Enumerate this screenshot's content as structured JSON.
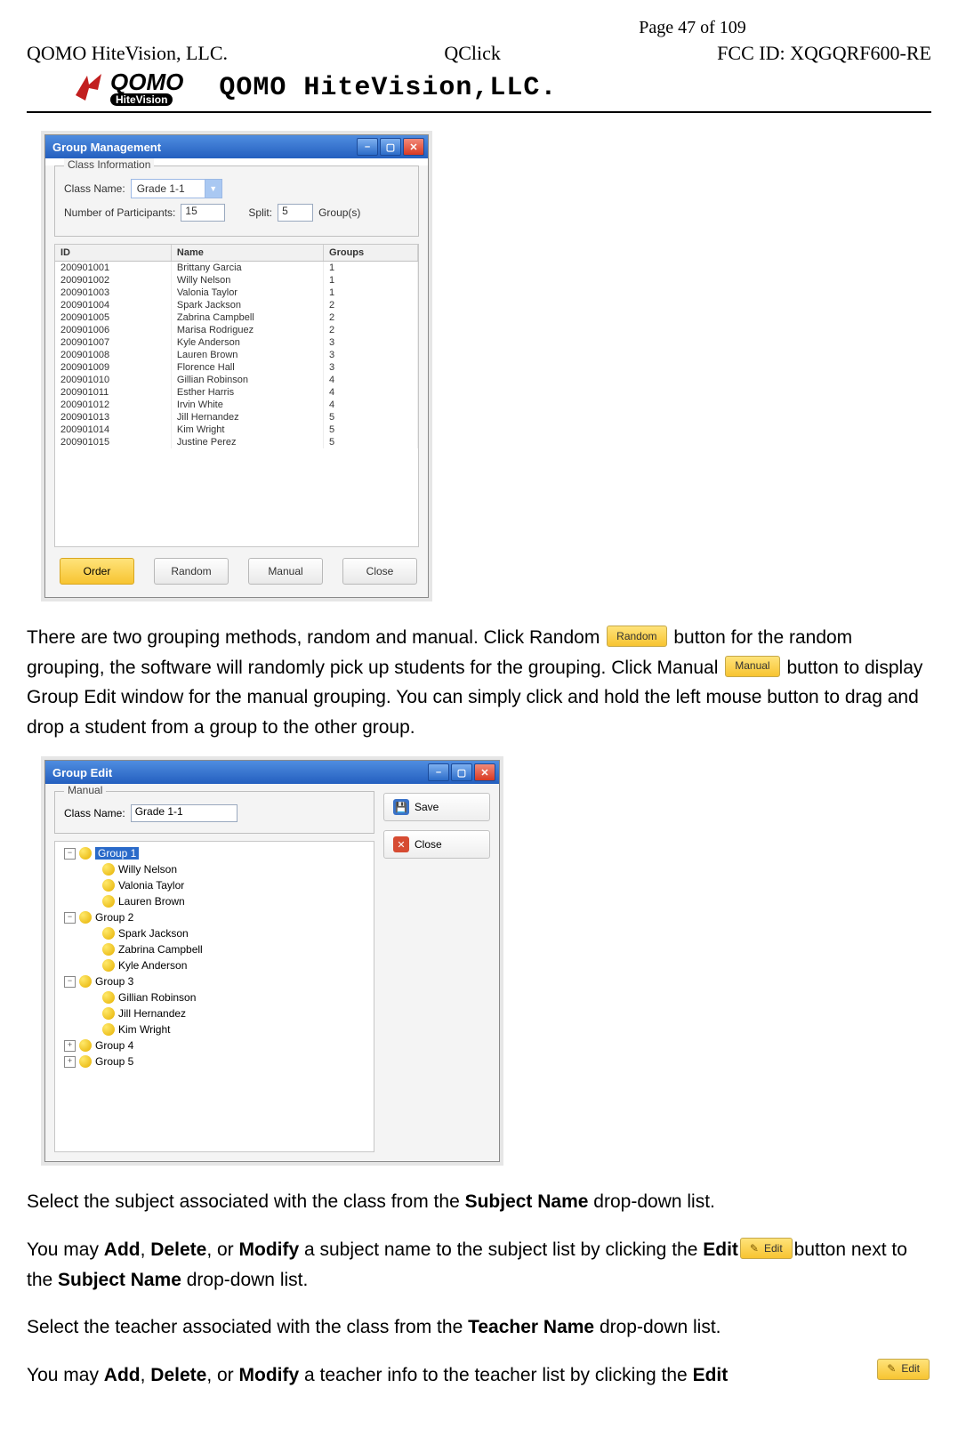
{
  "page_number": "Page 47 of 109",
  "header": {
    "left": "QOMO HiteVision, LLC.",
    "center": "QClick",
    "right": "FCC ID: XQGQRF600-RE"
  },
  "brand_title": "QOMO HiteVision,LLC.",
  "gm": {
    "title": "Group Management",
    "legend": "Class Information",
    "class_name_label": "Class Name:",
    "class_name_value": "Grade 1-1",
    "participants_label": "Number of Participants:",
    "participants_value": "15",
    "split_label": "Split:",
    "split_value": "5",
    "groups_suffix": "Group(s)",
    "columns": {
      "id": "ID",
      "name": "Name",
      "groups": "Groups"
    },
    "rows": [
      {
        "id": "200901001",
        "name": "Brittany Garcia",
        "group": "1"
      },
      {
        "id": "200901002",
        "name": "Willy Nelson",
        "group": "1"
      },
      {
        "id": "200901003",
        "name": "Valonia Taylor",
        "group": "1"
      },
      {
        "id": "200901004",
        "name": "Spark Jackson",
        "group": "2"
      },
      {
        "id": "200901005",
        "name": "Zabrina Campbell",
        "group": "2"
      },
      {
        "id": "200901006",
        "name": "Marisa Rodriguez",
        "group": "2"
      },
      {
        "id": "200901007",
        "name": "Kyle Anderson",
        "group": "3"
      },
      {
        "id": "200901008",
        "name": "Lauren Brown",
        "group": "3"
      },
      {
        "id": "200901009",
        "name": "Florence Hall",
        "group": "3"
      },
      {
        "id": "200901010",
        "name": "Gillian Robinson",
        "group": "4"
      },
      {
        "id": "200901011",
        "name": "Esther Harris",
        "group": "4"
      },
      {
        "id": "200901012",
        "name": "Irvin White",
        "group": "4"
      },
      {
        "id": "200901013",
        "name": "Jill Hernandez",
        "group": "5"
      },
      {
        "id": "200901014",
        "name": "Kim Wright",
        "group": "5"
      },
      {
        "id": "200901015",
        "name": "Justine Perez",
        "group": "5"
      }
    ],
    "buttons": {
      "order": "Order",
      "random": "Random",
      "manual": "Manual",
      "close": "Close"
    }
  },
  "para1": {
    "a": "There are two grouping methods, random and manual. Click Random ",
    "random_btn": "Random",
    "b": "button for the random grouping, the software will randomly pick up students for the grouping. Click Manual ",
    "manual_btn": "Manual",
    "c": " button to display Group Edit window    for the manual grouping. You can simply click and hold the left mouse button to drag and drop a student from a group to the other group."
  },
  "ge": {
    "title": "Group Edit",
    "legend": "Manual",
    "class_name_label": "Class Name:",
    "class_name_value": "Grade 1-1",
    "save_label": "Save",
    "close_label": "Close",
    "tree": [
      {
        "label": "Group 1",
        "expanded": true,
        "selected": true,
        "children": [
          "Willy Nelson",
          "Valonia Taylor",
          "Lauren Brown"
        ]
      },
      {
        "label": "Group 2",
        "expanded": true,
        "children": [
          "Spark Jackson",
          "Zabrina Campbell",
          "Kyle Anderson"
        ]
      },
      {
        "label": "Group 3",
        "expanded": true,
        "children": [
          "Gillian Robinson",
          "Jill Hernandez",
          "Kim Wright"
        ]
      },
      {
        "label": "Group 4",
        "expanded": false
      },
      {
        "label": "Group 5",
        "expanded": false
      }
    ]
  },
  "para2": {
    "a": "Select the subject associated with the class from the ",
    "b": "Subject Name",
    "c": " drop-down list."
  },
  "para3": {
    "a": "You may ",
    "add": "Add",
    "sep1": ", ",
    "del": "Delete",
    "sep2": ", or ",
    "mod": "Modify",
    "b": " a subject name to the subject list by clicking the ",
    "edit_word": "Edit",
    "edit_btn": "Edit",
    "c": "button next to the ",
    "d": "Subject Name",
    "e": " drop-down list."
  },
  "para4": {
    "a": "Select the teacher associated with the class from the ",
    "b": "Teacher Name",
    "c": " drop-down list."
  },
  "para5": {
    "a": "You may ",
    "add": "Add",
    "sep1": ", ",
    "del": "Delete",
    "sep2": ", or ",
    "mod": "Modify",
    "b": " a teacher info to the teacher list by clicking the ",
    "edit_word": "Edit",
    "edit_btn": "Edit"
  }
}
